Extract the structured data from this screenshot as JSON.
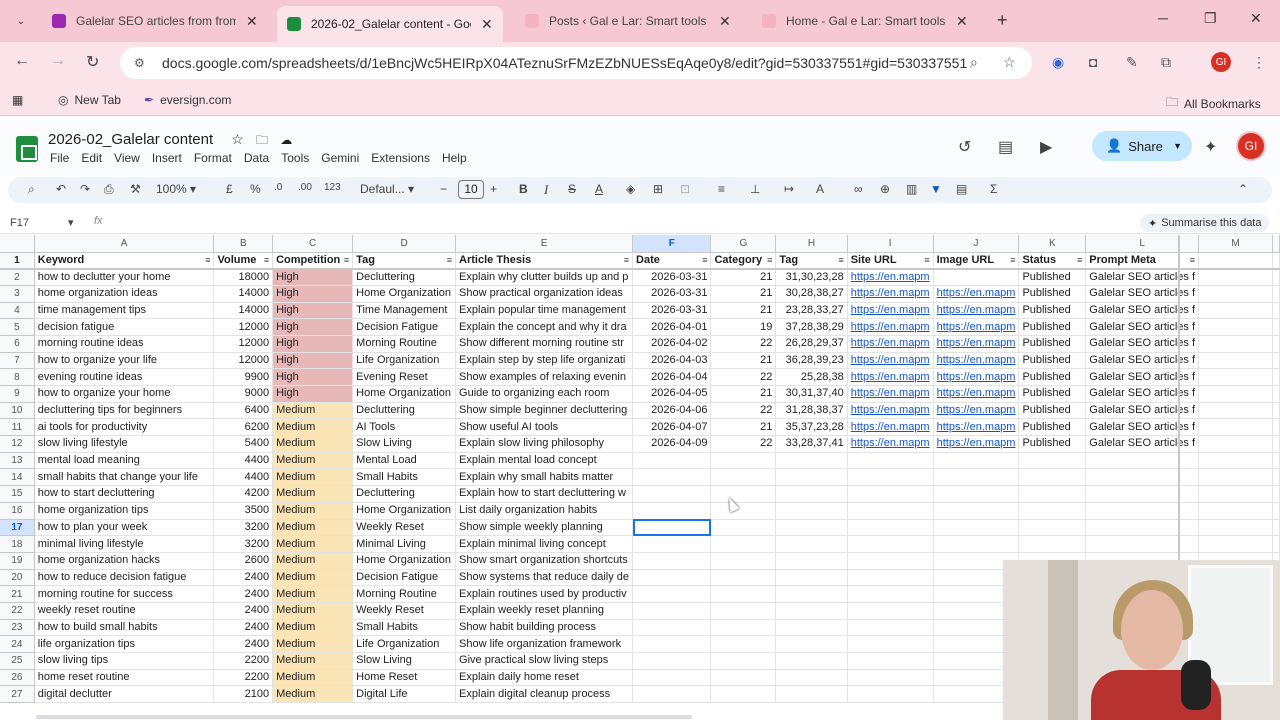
{
  "browser": {
    "tabs": [
      {
        "title": "Galelar SEO articles from from i",
        "favicon_color": "#9c27b0"
      },
      {
        "title": "2026-02_Galelar content - Goo",
        "favicon_color": "#1e8e3e"
      },
      {
        "title": "Posts ‹ Gal e Lar: Smart tools fo",
        "favicon_color": "#f6c8d4"
      },
      {
        "title": "Home - Gal e Lar: Smart tools fo",
        "favicon_color": "#f6c8d4"
      }
    ],
    "url": "docs.google.com/spreadsheets/d/1eBncjWc5HEIRpX04ATeznuSrFMzEZbNUESsEqAqe0y8/edit?gid=530337551#gid=530337551",
    "bookmarks": [
      {
        "label": "New Tab"
      },
      {
        "label": "eversign.com"
      }
    ],
    "all_bookmarks": "All Bookmarks"
  },
  "sheets": {
    "doc_title": "2026-02_Galelar content",
    "menu": [
      "File",
      "Edit",
      "View",
      "Insert",
      "Format",
      "Data",
      "Tools",
      "Gemini",
      "Extensions",
      "Help"
    ],
    "share_label": "Share",
    "avatar_initials": "GI",
    "zoom": "100%",
    "currency": "£",
    "percent": "%",
    "dec_minus": ".0",
    "dec_plus": ".00",
    "num_fmt": "123",
    "font": "Defaul...",
    "font_size": "10",
    "cell_ref": "F17",
    "fx": "fx",
    "summarise": "Summarise this data"
  },
  "grid": {
    "columns": [
      "A",
      "B",
      "C",
      "D",
      "E",
      "F",
      "G",
      "H",
      "I",
      "J",
      "K",
      "L",
      "M"
    ],
    "selected_column": "F",
    "selected_row": "17",
    "headers": [
      "Keyword",
      "Volume",
      "Competition",
      "Tag",
      "Article Thesis",
      "Date",
      "Category",
      "Tag",
      "Site URL",
      "Image URL",
      "Status",
      "Prompt Meta"
    ],
    "rows": [
      {
        "n": "2",
        "kw": "how to declutter your home",
        "vol": "18000",
        "comp": "High",
        "tag": "Decluttering",
        "thesis": "Explain why clutter builds up and p",
        "date": "2026-03-31",
        "cat": "21",
        "tag2": "31,30,23,28",
        "site": "https://en.mapm",
        "img": "",
        "status": "Published",
        "meta": "Galelar SEO articles f"
      },
      {
        "n": "3",
        "kw": "home organization ideas",
        "vol": "14000",
        "comp": "High",
        "tag": "Home Organization",
        "thesis": "Show practical organization ideas",
        "date": "2026-03-31",
        "cat": "21",
        "tag2": "30,28,38,27",
        "site": "https://en.mapm",
        "img": "https://en.mapm",
        "status": "Published",
        "meta": "Galelar SEO articles f"
      },
      {
        "n": "4",
        "kw": "time management tips",
        "vol": "14000",
        "comp": "High",
        "tag": "Time Management",
        "thesis": "Explain popular time management",
        "date": "2026-03-31",
        "cat": "21",
        "tag2": "23,28,33,27",
        "site": "https://en.mapm",
        "img": "https://en.mapm",
        "status": "Published",
        "meta": "Galelar SEO articles f"
      },
      {
        "n": "5",
        "kw": "decision fatigue",
        "vol": "12000",
        "comp": "High",
        "tag": "Decision Fatigue",
        "thesis": "Explain the concept and why it dra",
        "date": "2026-04-01",
        "cat": "19",
        "tag2": "37,28,38,29",
        "site": "https://en.mapm",
        "img": "https://en.mapm",
        "status": "Published",
        "meta": "Galelar SEO articles f"
      },
      {
        "n": "6",
        "kw": "morning routine ideas",
        "vol": "12000",
        "comp": "High",
        "tag": "Morning Routine",
        "thesis": "Show different morning routine str",
        "date": "2026-04-02",
        "cat": "22",
        "tag2": "26,28,29,37",
        "site": "https://en.mapm",
        "img": "https://en.mapm",
        "status": "Published",
        "meta": "Galelar SEO articles f"
      },
      {
        "n": "7",
        "kw": "how to organize your life",
        "vol": "12000",
        "comp": "High",
        "tag": "Life Organization",
        "thesis": "Explain step by step life organizati",
        "date": "2026-04-03",
        "cat": "21",
        "tag2": "36,28,39,23",
        "site": "https://en.mapm",
        "img": "https://en.mapm",
        "status": "Published",
        "meta": "Galelar SEO articles f"
      },
      {
        "n": "8",
        "kw": "evening routine ideas",
        "vol": "9900",
        "comp": "High",
        "tag": "Evening Reset",
        "thesis": "Show examples of relaxing evenin",
        "date": "2026-04-04",
        "cat": "22",
        "tag2": "25,28,38",
        "site": "https://en.mapm",
        "img": "https://en.mapm",
        "status": "Published",
        "meta": "Galelar SEO articles f"
      },
      {
        "n": "9",
        "kw": "how to organize your home",
        "vol": "9000",
        "comp": "High",
        "tag": "Home Organization",
        "thesis": "Guide to organizing each room",
        "date": "2026-04-05",
        "cat": "21",
        "tag2": "30,31,37,40",
        "site": "https://en.mapm",
        "img": "https://en.mapm",
        "status": "Published",
        "meta": "Galelar SEO articles f"
      },
      {
        "n": "10",
        "kw": "decluttering tips for beginners",
        "vol": "6400",
        "comp": "Medium",
        "tag": "Decluttering",
        "thesis": "Show simple beginner decluttering",
        "date": "2026-04-06",
        "cat": "22",
        "tag2": "31,28,38,37",
        "site": "https://en.mapm",
        "img": "https://en.mapm",
        "status": "Published",
        "meta": "Galelar SEO articles f"
      },
      {
        "n": "11",
        "kw": "ai tools for productivity",
        "vol": "6200",
        "comp": "Medium",
        "tag": "AI Tools",
        "thesis": "Show useful AI tools",
        "date": "2026-04-07",
        "cat": "21",
        "tag2": "35,37,23,28",
        "site": "https://en.mapm",
        "img": "https://en.mapm",
        "status": "Published",
        "meta": "Galelar SEO articles f"
      },
      {
        "n": "12",
        "kw": "slow living lifestyle",
        "vol": "5400",
        "comp": "Medium",
        "tag": "Slow Living",
        "thesis": "Explain slow living philosophy",
        "date": "2026-04-09",
        "cat": "22",
        "tag2": "33,28,37,41",
        "site": "https://en.mapm",
        "img": "https://en.mapm",
        "status": "Published",
        "meta": "Galelar SEO articles f"
      },
      {
        "n": "13",
        "kw": "mental load meaning",
        "vol": "4400",
        "comp": "Medium",
        "tag": "Mental Load",
        "thesis": "Explain mental load concept",
        "date": "",
        "cat": "",
        "tag2": "",
        "site": "",
        "img": "",
        "status": "",
        "meta": ""
      },
      {
        "n": "14",
        "kw": "small habits that change your life",
        "vol": "4400",
        "comp": "Medium",
        "tag": "Small Habits",
        "thesis": "Explain why small habits matter",
        "date": "",
        "cat": "",
        "tag2": "",
        "site": "",
        "img": "",
        "status": "",
        "meta": ""
      },
      {
        "n": "15",
        "kw": "how to start decluttering",
        "vol": "4200",
        "comp": "Medium",
        "tag": "Decluttering",
        "thesis": "Explain how to start decluttering w",
        "date": "",
        "cat": "",
        "tag2": "",
        "site": "",
        "img": "",
        "status": "",
        "meta": ""
      },
      {
        "n": "16",
        "kw": "home organization tips",
        "vol": "3500",
        "comp": "Medium",
        "tag": "Home Organization",
        "thesis": "List daily organization habits",
        "date": "",
        "cat": "",
        "tag2": "",
        "site": "",
        "img": "",
        "status": "",
        "meta": ""
      },
      {
        "n": "17",
        "kw": "how to plan your week",
        "vol": "3200",
        "comp": "Medium",
        "tag": "Weekly Reset",
        "thesis": "Show simple weekly planning",
        "date": "",
        "cat": "",
        "tag2": "",
        "site": "",
        "img": "",
        "status": "",
        "meta": ""
      },
      {
        "n": "18",
        "kw": "minimal living lifestyle",
        "vol": "3200",
        "comp": "Medium",
        "tag": "Minimal Living",
        "thesis": "Explain minimal living concept",
        "date": "",
        "cat": "",
        "tag2": "",
        "site": "",
        "img": "",
        "status": "",
        "meta": ""
      },
      {
        "n": "19",
        "kw": "home organization hacks",
        "vol": "2600",
        "comp": "Medium",
        "tag": "Home Organization",
        "thesis": "Show smart organization shortcuts",
        "date": "",
        "cat": "",
        "tag2": "",
        "site": "",
        "img": "",
        "status": "",
        "meta": ""
      },
      {
        "n": "20",
        "kw": "how to reduce decision fatigue",
        "vol": "2400",
        "comp": "Medium",
        "tag": "Decision Fatigue",
        "thesis": "Show systems that reduce daily de",
        "date": "",
        "cat": "",
        "tag2": "",
        "site": "",
        "img": "",
        "status": "",
        "meta": ""
      },
      {
        "n": "21",
        "kw": "morning routine for success",
        "vol": "2400",
        "comp": "Medium",
        "tag": "Morning Routine",
        "thesis": "Explain routines used by productiv",
        "date": "",
        "cat": "",
        "tag2": "",
        "site": "",
        "img": "",
        "status": "",
        "meta": ""
      },
      {
        "n": "22",
        "kw": "weekly reset routine",
        "vol": "2400",
        "comp": "Medium",
        "tag": "Weekly Reset",
        "thesis": "Explain weekly reset planning",
        "date": "",
        "cat": "",
        "tag2": "",
        "site": "",
        "img": "",
        "status": "",
        "meta": ""
      },
      {
        "n": "23",
        "kw": "how to build small habits",
        "vol": "2400",
        "comp": "Medium",
        "tag": "Small Habits",
        "thesis": "Show habit building process",
        "date": "",
        "cat": "",
        "tag2": "",
        "site": "",
        "img": "",
        "status": "",
        "meta": ""
      },
      {
        "n": "24",
        "kw": "life organization tips",
        "vol": "2400",
        "comp": "Medium",
        "tag": "Life Organization",
        "thesis": "Show life organization framework",
        "date": "",
        "cat": "",
        "tag2": "",
        "site": "",
        "img": "",
        "status": "",
        "meta": ""
      },
      {
        "n": "25",
        "kw": "slow living tips",
        "vol": "2200",
        "comp": "Medium",
        "tag": "Slow Living",
        "thesis": "Give practical slow living steps",
        "date": "",
        "cat": "",
        "tag2": "",
        "site": "",
        "img": "",
        "status": "",
        "meta": ""
      },
      {
        "n": "26",
        "kw": "home reset routine",
        "vol": "2200",
        "comp": "Medium",
        "tag": "Home Reset",
        "thesis": "Explain daily home reset",
        "date": "",
        "cat": "",
        "tag2": "",
        "site": "",
        "img": "",
        "status": "",
        "meta": ""
      },
      {
        "n": "27",
        "kw": "digital declutter",
        "vol": "2100",
        "comp": "Medium",
        "tag": "Digital Life",
        "thesis": "Explain digital cleanup process",
        "date": "",
        "cat": "",
        "tag2": "",
        "site": "",
        "img": "",
        "status": "",
        "meta": ""
      }
    ]
  },
  "colors": {
    "high": "#e6b8b8",
    "medium": "#fbe5b6",
    "link": "#1155cc",
    "selection": "#1a73e8",
    "chrome_pink": "#f6c8d4"
  }
}
